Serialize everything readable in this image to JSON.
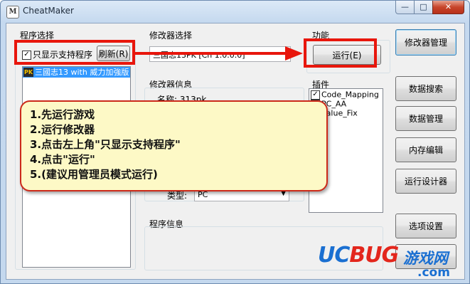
{
  "window": {
    "title": "CheatMaker",
    "icon": "cheatmaker-logo-icon",
    "minimize_glyph": "—",
    "maximize_glyph": "□",
    "close_glyph": "✕"
  },
  "left_panel": {
    "group_label": "程序选择",
    "filter_checkbox": {
      "label": "只显示支持程序",
      "checked": true
    },
    "refresh_button": "刷新(R)",
    "program_list": [
      {
        "icon": "game-icon",
        "label": "三國志13 with 威力加強版"
      }
    ]
  },
  "modifier_select": {
    "label": "修改器选择",
    "value": "三国志13PK [Ch 1.0.0.0]"
  },
  "function": {
    "label": "功能",
    "run_button": "运行(E)"
  },
  "modifier_info": {
    "label": "修改器信息",
    "name_label": "名称:",
    "name_value": "313pk",
    "type_label": "类型:",
    "type_value": "PC"
  },
  "plugins": {
    "label": "插件",
    "items": [
      {
        "label": "Code_Mapping",
        "checked": true
      },
      {
        "label": "PC_AA",
        "checked": true
      },
      {
        "label": "Value_Fix",
        "checked": true
      }
    ]
  },
  "program_info": {
    "label": "程序信息"
  },
  "sidebar_buttons": [
    "修改器管理",
    "数据搜索",
    "数据管理",
    "内存编辑",
    "运行设计器",
    "选项设置"
  ],
  "annotation": {
    "lines": [
      "1.先运行游戏",
      "2.运行修改器",
      "3.点击左上角\"只显示支持程序\"",
      "4.点击\"运行\"",
      "5.(建议用管理员模式运行)"
    ],
    "accent_color": "#e8160c"
  },
  "watermark": {
    "brand_part1": "UC",
    "brand_part2": "BUG",
    "brand_tail": "游戏网",
    "domain": ".com",
    "color_blue": "#1a6fd1",
    "color_red": "#e3261c"
  }
}
